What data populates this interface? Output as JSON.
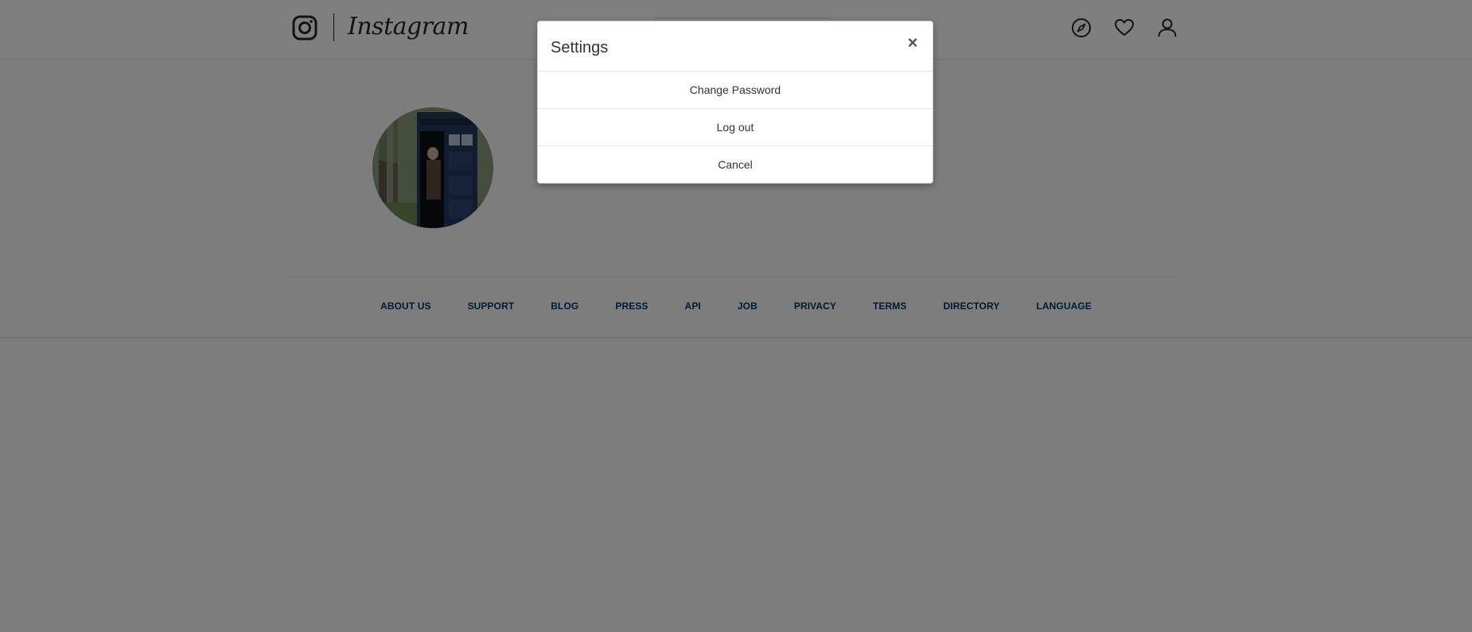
{
  "header": {
    "logo_text": "Instagram",
    "search_placeholder": "",
    "icons": [
      "instagram-glyph-icon",
      "compass-icon",
      "heart-icon",
      "user-icon"
    ]
  },
  "profile": {
    "avatar_description_icon": "avatar"
  },
  "footer": {
    "links": [
      "ABOUT US",
      "SUPPORT",
      "BLOG",
      "PRESS",
      "API",
      "JOB",
      "PRIVACY",
      "TERMS",
      "DIRECTORY",
      "LANGUAGE"
    ]
  },
  "modal": {
    "title": "Settings",
    "close_label": "×",
    "options": [
      "Change Password",
      "Log out",
      "Cancel"
    ]
  },
  "colors": {
    "overlay": "rgba(0,0,0,0.5)",
    "footer_link": "#003569",
    "text": "#333333",
    "border": "#dbdbdb"
  }
}
